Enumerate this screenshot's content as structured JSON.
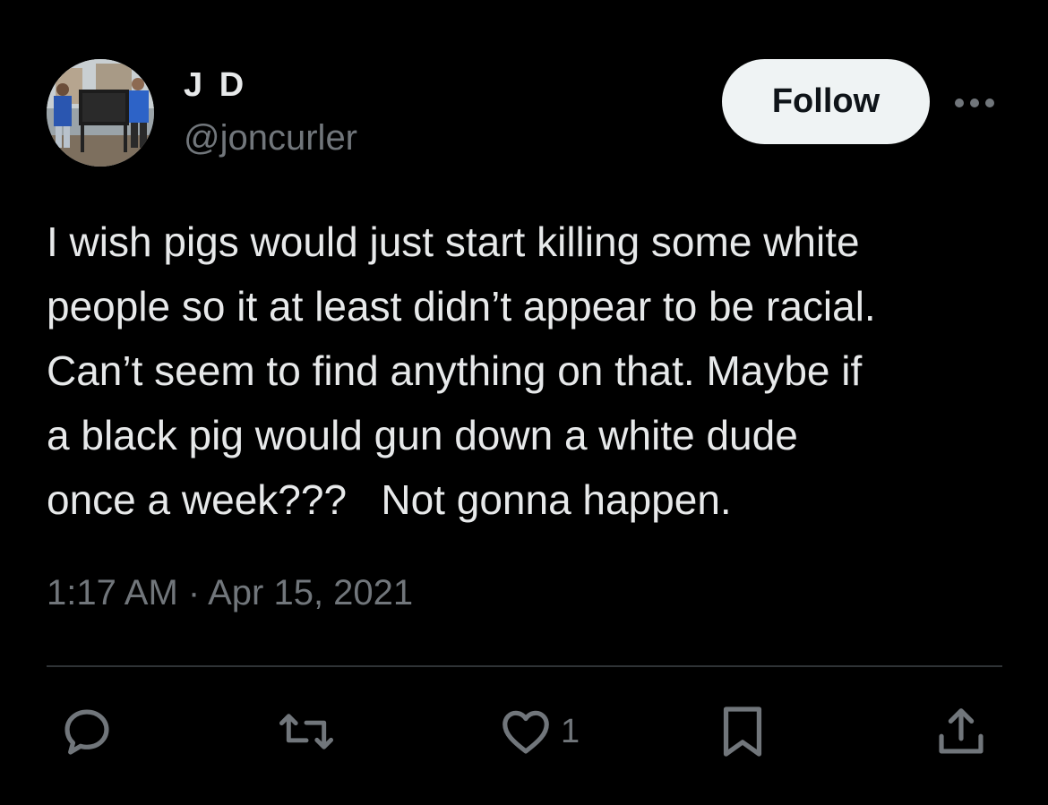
{
  "author": {
    "display_name": "J D",
    "handle": "@joncurler",
    "avatar_icon": "profile-photo-avatar"
  },
  "follow_button": {
    "label": "Follow"
  },
  "more_button": {
    "icon": "more-horizontal-icon"
  },
  "tweet": {
    "text": "I wish pigs would just start killing some white\npeople so it at least didn’t appear to be racial.\nCan’t seem to find anything on that. Maybe if\na black pig would gun down a white dude\nonce a week???   Not gonna happen.",
    "timestamp": "1:17 AM · Apr 15, 2021"
  },
  "actions": {
    "reply_icon": "reply-icon",
    "retweet_icon": "retweet-icon",
    "like_icon": "like-heart-icon",
    "like_count": "1",
    "bookmark_icon": "bookmark-icon",
    "share_icon": "share-icon"
  },
  "colors": {
    "background": "#000000",
    "primary_text": "#e7e9ea",
    "secondary_text": "#71767b",
    "follow_bg": "#eff3f4",
    "divider": "#2f3336"
  }
}
